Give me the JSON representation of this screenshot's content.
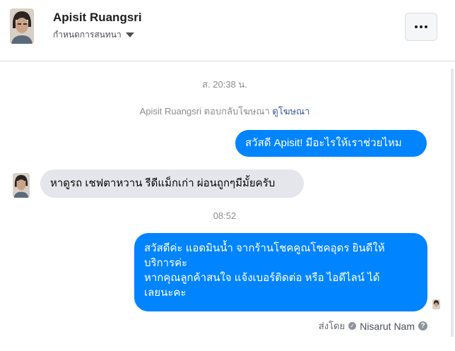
{
  "header": {
    "contact_name": "Apisit Ruangsri",
    "subtitle": "กำหนดการสนทนา",
    "more_icon": "more-horizontal-icon"
  },
  "thread": {
    "timestamp_1": "ส. 20:38 น.",
    "reply_note": {
      "text": "Apisit Ruangsri ตอบกลับโฆษณา",
      "link": "ดูโฆษณา"
    },
    "messages": [
      {
        "direction": "outgoing",
        "text": "สวัสดี Apisit! มีอะไรให้เราช่วยไหม"
      },
      {
        "direction": "incoming",
        "text": "หาดูรถ เชฟตาหวาน รีดีแม็กเก่า ผ่อนถูกๆมีมั้ยครับ"
      }
    ],
    "timestamp_2": "08:52",
    "last_message": {
      "direction": "outgoing",
      "lines": [
        "สวัสดีค่ะ แอดมินน้ำ จากร้านโชคคูณโชคอุดร ยินดีให้",
        "บริการค่ะ",
        "หากคุณลูกค้าสนใจ แจ้งเบอร์ติดต่อ หรือ ไอดีไลน์ ได้",
        "เลยนะคะ"
      ]
    },
    "sent_by": {
      "label": "ส่งโดย",
      "name": "Nisarut Nam",
      "verified_icon": "check-circle-icon",
      "help_icon": "question-circle-icon"
    }
  },
  "colors": {
    "outgoing_bubble": "#0084ff",
    "incoming_bubble": "#e4e6eb",
    "meta_text": "#8a8d91",
    "link": "#385898"
  }
}
